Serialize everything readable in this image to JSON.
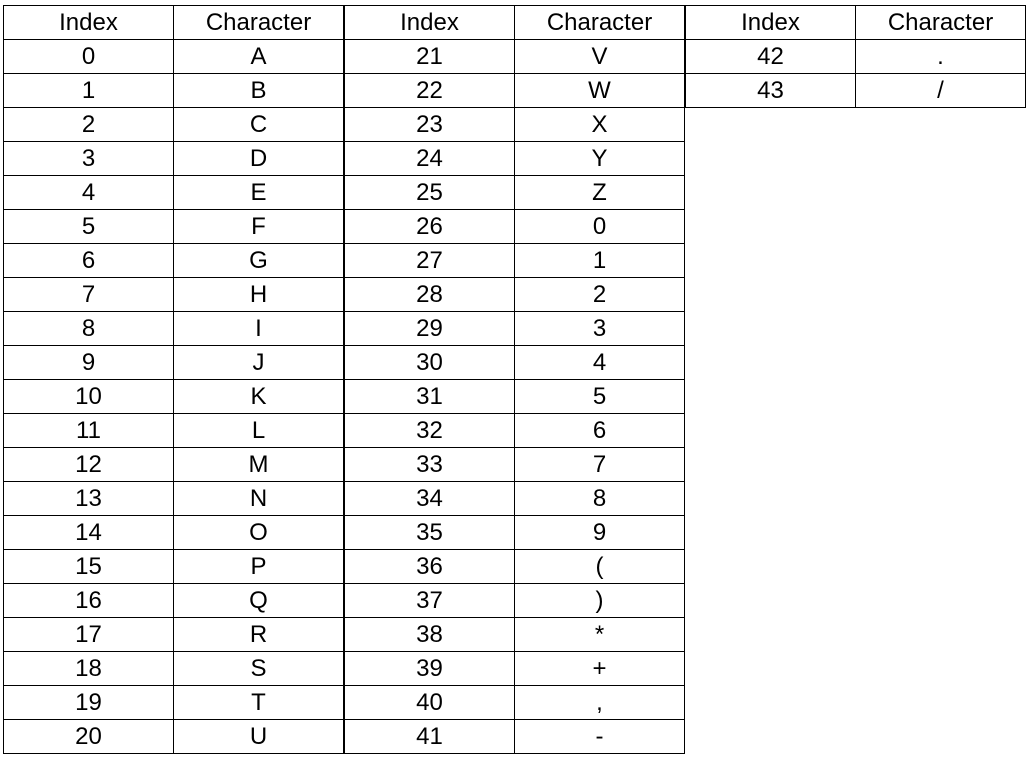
{
  "tables": [
    {
      "headers": [
        "Index",
        "Character"
      ],
      "rows": [
        [
          "0",
          "A"
        ],
        [
          "1",
          "B"
        ],
        [
          "2",
          "C"
        ],
        [
          "3",
          "D"
        ],
        [
          "4",
          "E"
        ],
        [
          "5",
          "F"
        ],
        [
          "6",
          "G"
        ],
        [
          "7",
          "H"
        ],
        [
          "8",
          "I"
        ],
        [
          "9",
          "J"
        ],
        [
          "10",
          "K"
        ],
        [
          "11",
          "L"
        ],
        [
          "12",
          "M"
        ],
        [
          "13",
          "N"
        ],
        [
          "14",
          "O"
        ],
        [
          "15",
          "P"
        ],
        [
          "16",
          "Q"
        ],
        [
          "17",
          "R"
        ],
        [
          "18",
          "S"
        ],
        [
          "19",
          "T"
        ],
        [
          "20",
          "U"
        ]
      ]
    },
    {
      "headers": [
        "Index",
        "Character"
      ],
      "rows": [
        [
          "21",
          "V"
        ],
        [
          "22",
          "W"
        ],
        [
          "23",
          "X"
        ],
        [
          "24",
          "Y"
        ],
        [
          "25",
          "Z"
        ],
        [
          "26",
          "0"
        ],
        [
          "27",
          "1"
        ],
        [
          "28",
          "2"
        ],
        [
          "29",
          "3"
        ],
        [
          "30",
          "4"
        ],
        [
          "31",
          "5"
        ],
        [
          "32",
          "6"
        ],
        [
          "33",
          "7"
        ],
        [
          "34",
          "8"
        ],
        [
          "35",
          "9"
        ],
        [
          "36",
          "("
        ],
        [
          "37",
          ")"
        ],
        [
          "38",
          "*"
        ],
        [
          "39",
          "+"
        ],
        [
          "40",
          ","
        ],
        [
          "41",
          "-"
        ]
      ]
    },
    {
      "headers": [
        "Index",
        "Character"
      ],
      "rows": [
        [
          "42",
          "."
        ],
        [
          "43",
          "/"
        ]
      ]
    }
  ]
}
